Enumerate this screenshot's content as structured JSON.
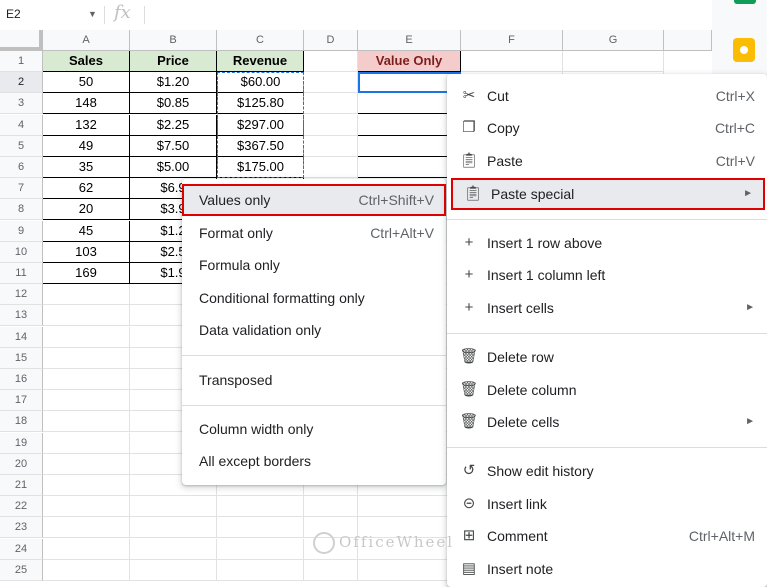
{
  "formula_bar": {
    "cell_ref": "E2",
    "fx": "fx"
  },
  "columns": [
    "A",
    "B",
    "C",
    "D",
    "E",
    "F",
    "G"
  ],
  "rows": [
    "1",
    "2",
    "3",
    "4",
    "5",
    "6",
    "7",
    "8",
    "9",
    "10",
    "11",
    "12",
    "13",
    "14",
    "15",
    "16",
    "17",
    "18",
    "19",
    "20",
    "21",
    "22",
    "23",
    "24",
    "25"
  ],
  "table": {
    "headers": [
      "Sales",
      "Price",
      "Revenue"
    ],
    "value_only_header": "Value Only",
    "data": [
      [
        "50",
        "$1.20",
        "$60.00"
      ],
      [
        "148",
        "$0.85",
        "$125.80"
      ],
      [
        "132",
        "$2.25",
        "$297.00"
      ],
      [
        "49",
        "$7.50",
        "$367.50"
      ],
      [
        "35",
        "$5.00",
        "$175.00"
      ],
      [
        "62",
        "$6.9",
        ""
      ],
      [
        "20",
        "$3.9",
        ""
      ],
      [
        "45",
        "$1.2",
        ""
      ],
      [
        "103",
        "$2.5",
        ""
      ],
      [
        "169",
        "$1.9",
        ""
      ]
    ]
  },
  "context_menu": {
    "cut": {
      "label": "Cut",
      "shortcut": "Ctrl+X"
    },
    "copy": {
      "label": "Copy",
      "shortcut": "Ctrl+C"
    },
    "paste": {
      "label": "Paste",
      "shortcut": "Ctrl+V"
    },
    "paste_special": {
      "label": "Paste special",
      "arrow": "►"
    },
    "insert_row_above": {
      "label": "Insert 1 row above"
    },
    "insert_column_left": {
      "label": "Insert 1 column left"
    },
    "insert_cells": {
      "label": "Insert cells",
      "arrow": "►"
    },
    "delete_row": {
      "label": "Delete row"
    },
    "delete_column": {
      "label": "Delete column"
    },
    "delete_cells": {
      "label": "Delete cells",
      "arrow": "►"
    },
    "show_edit_history": {
      "label": "Show edit history"
    },
    "insert_link": {
      "label": "Insert link"
    },
    "comment": {
      "label": "Comment",
      "shortcut": "Ctrl+Alt+M"
    },
    "insert_note": {
      "label": "Insert note"
    }
  },
  "paste_special_menu": {
    "values_only": {
      "label": "Values only",
      "shortcut": "Ctrl+Shift+V"
    },
    "format_only": {
      "label": "Format only",
      "shortcut": "Ctrl+Alt+V"
    },
    "formula_only": {
      "label": "Formula only"
    },
    "conditional_formatting_only": {
      "label": "Conditional formatting only"
    },
    "data_validation_only": {
      "label": "Data validation only"
    },
    "transposed": {
      "label": "Transposed"
    },
    "column_width_only": {
      "label": "Column width only"
    },
    "all_except_borders": {
      "label": "All except borders"
    }
  },
  "watermark": "OfficeWheel",
  "colors": {
    "header_green": "#d9ead3",
    "header_red": "#f4cccc",
    "highlight_border": "#e00000",
    "selection_blue": "#1a73e8"
  }
}
